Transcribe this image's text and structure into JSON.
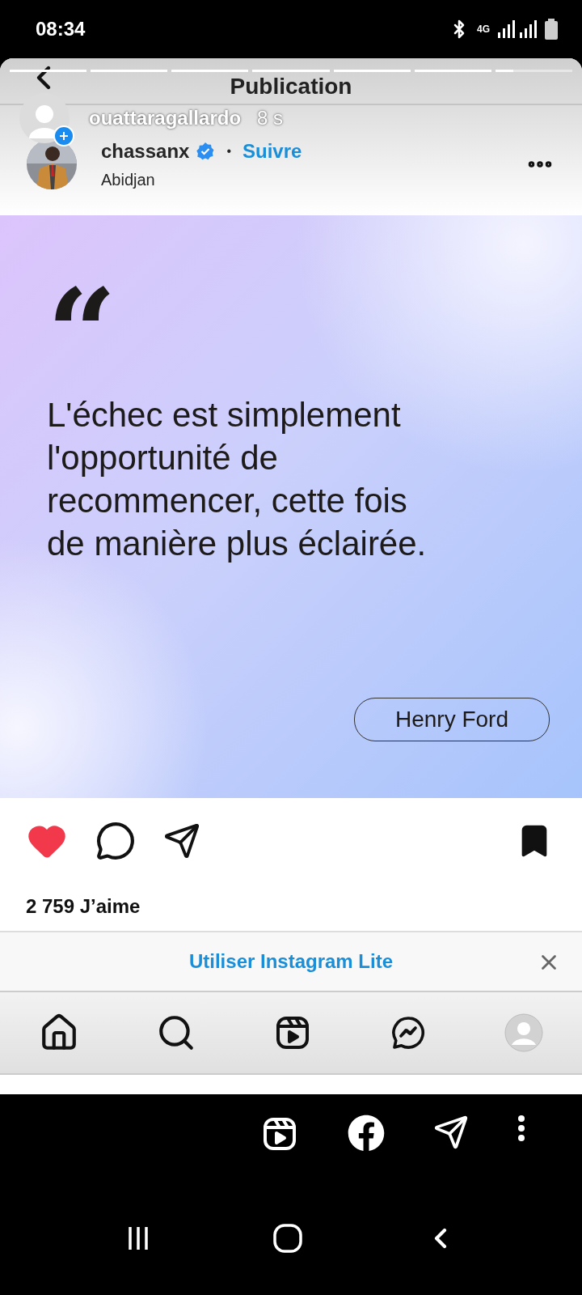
{
  "status_bar": {
    "time": "08:34",
    "network": "4G"
  },
  "story": {
    "segments": [
      {
        "level": 1
      },
      {
        "level": 1
      },
      {
        "level": 1
      },
      {
        "level": 1
      },
      {
        "level": 1
      },
      {
        "level": 1
      },
      {
        "level": 0.23
      }
    ],
    "user": "ouattaragallardo",
    "age": "8 s"
  },
  "page": {
    "title": "Publication"
  },
  "post": {
    "author": "chassanx",
    "verified": true,
    "separator": "•",
    "follow": "Suivre",
    "location": "Abidjan",
    "quote_mark": "“",
    "quote": "L'échec est simplement\nl'opportunité de\nrecommencer, cette fois\nde manière plus éclairée.",
    "quote_author": "Henry Ford",
    "liked": true,
    "saved": true,
    "likes": "2 759 J’aime"
  },
  "banner": {
    "label": "Utiliser Instagram Lite"
  },
  "nav": [
    {
      "kind": "home"
    },
    {
      "kind": "search"
    },
    {
      "kind": "reels"
    },
    {
      "kind": "messenger"
    },
    {
      "kind": "profile"
    }
  ],
  "story_actions": [
    {
      "kind": "reels"
    },
    {
      "kind": "facebook"
    },
    {
      "kind": "send"
    },
    {
      "kind": "more"
    }
  ]
}
